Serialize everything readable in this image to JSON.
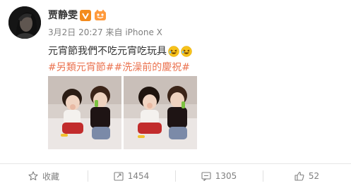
{
  "user": {
    "name": "贾静雯",
    "verified_icon": "verified-v-icon",
    "level_icon": "vip-level-icon"
  },
  "post": {
    "time": "3月2日 20:27",
    "source_prefix": "来自",
    "source": "iPhone X",
    "text": "元宵節我們不吃元宵吃玩具",
    "emojis": [
      "laughing-emoji",
      "laughing-emoji"
    ],
    "hashtags": "#另類元宵節##洗澡前的慶祝#",
    "images": [
      "photo-kids-1",
      "photo-kids-2"
    ]
  },
  "actions": {
    "favorite_label": "收藏",
    "repost_count": "1454",
    "comment_count": "1305",
    "like_count": "52"
  },
  "colors": {
    "hashtag": "#eb7350",
    "verified": "#f38b1d",
    "meta_text": "#808080"
  }
}
